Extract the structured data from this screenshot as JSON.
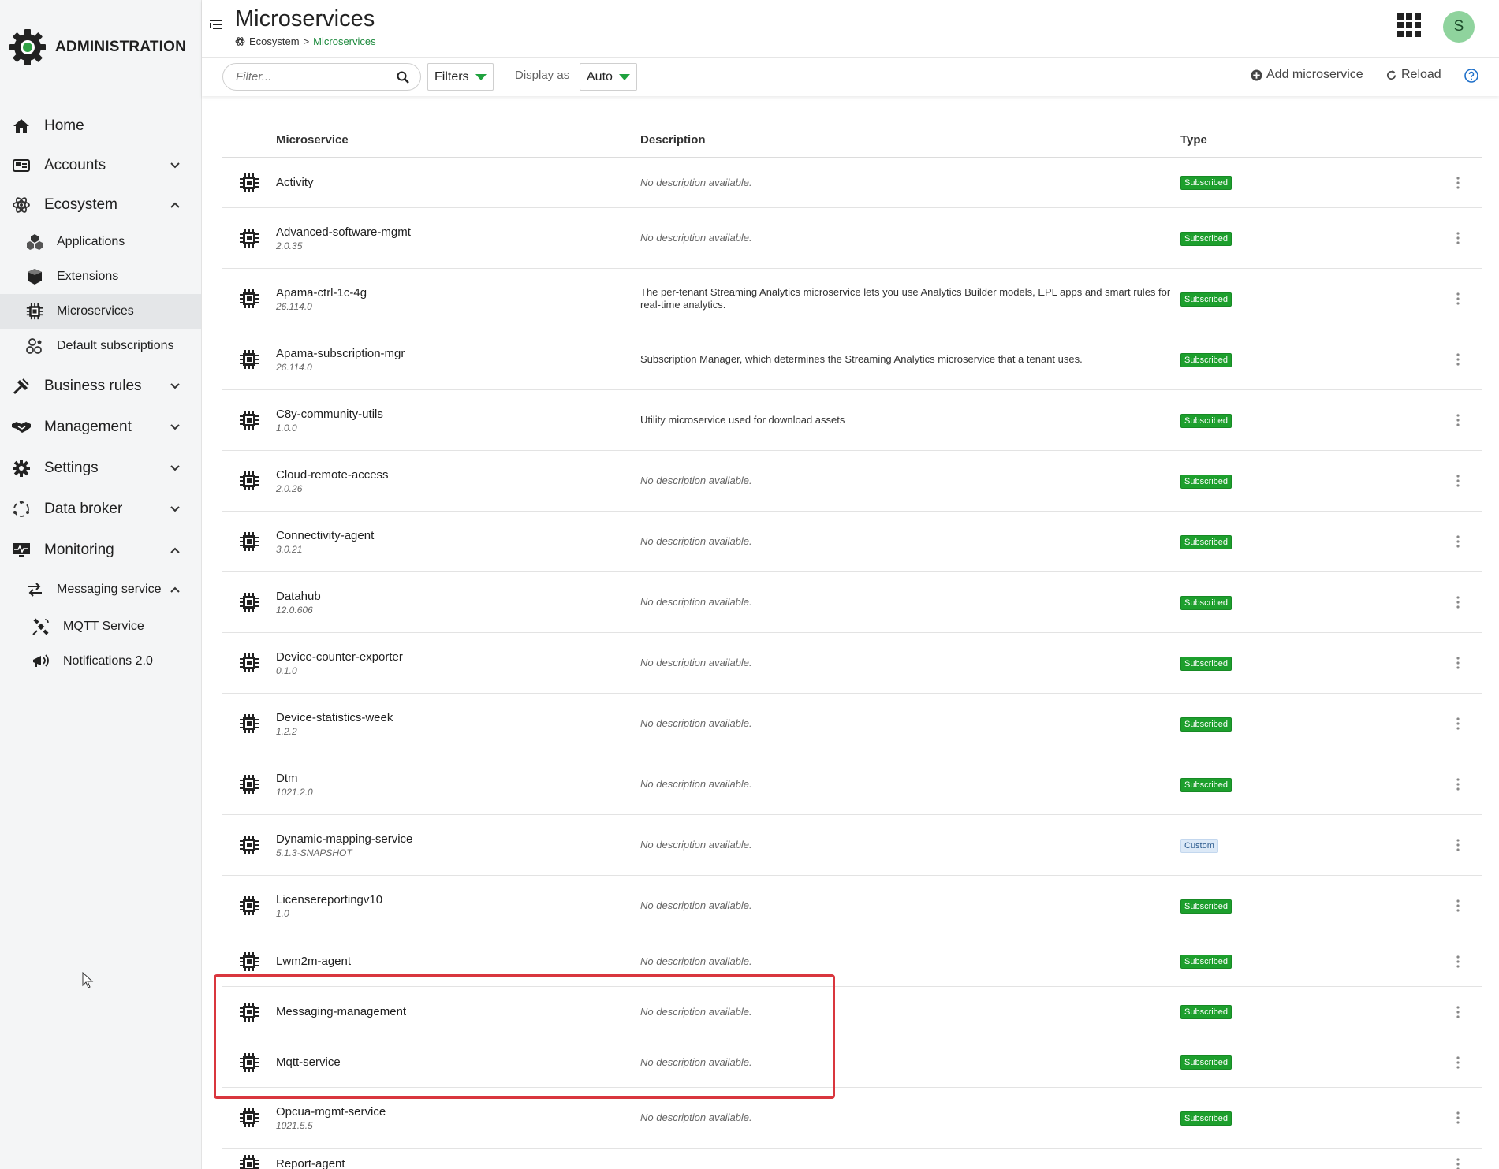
{
  "app": {
    "brand_name": "ADMINISTRATION",
    "page_title": "Microservices",
    "breadcrumb": {
      "parent": "Ecosystem",
      "separator": ">",
      "current": "Microservices"
    },
    "user_initial": "S"
  },
  "sidebar": {
    "home": "Home",
    "accounts": "Accounts",
    "ecosystem": "Ecosystem",
    "ecosystem_items": {
      "applications": "Applications",
      "extensions": "Extensions",
      "microservices": "Microservices",
      "default_subscriptions": "Default subscriptions"
    },
    "business_rules": "Business rules",
    "management": "Management",
    "settings": "Settings",
    "data_broker": "Data broker",
    "monitoring": "Monitoring",
    "messaging_service": "Messaging service",
    "messaging_items": {
      "mqtt": "MQTT Service",
      "notifications": "Notifications 2.0"
    },
    "active_item": "Microservices"
  },
  "toolbar": {
    "filter_placeholder": "Filter...",
    "filters_label": "Filters",
    "display_as_label": "Display as",
    "display_as_value": "Auto",
    "add_label": "Add microservice",
    "reload_label": "Reload"
  },
  "table": {
    "headers": {
      "name": "Microservice",
      "description": "Description",
      "type": "Type"
    },
    "rows": [
      {
        "name": "Activity",
        "version": "",
        "description": "No description available.",
        "type": "Subscribed"
      },
      {
        "name": "Advanced-software-mgmt",
        "version": "2.0.35",
        "description": "No description available.",
        "type": "Subscribed"
      },
      {
        "name": "Apama-ctrl-1c-4g",
        "version": "26.114.0",
        "description": "The per-tenant Streaming Analytics microservice lets you use Analytics Builder models, EPL apps and smart rules for real-time analytics.",
        "type": "Subscribed"
      },
      {
        "name": "Apama-subscription-mgr",
        "version": "26.114.0",
        "description": "Subscription Manager, which determines the Streaming Analytics microservice that a tenant uses.",
        "type": "Subscribed"
      },
      {
        "name": "C8y-community-utils",
        "version": "1.0.0",
        "description": "Utility microservice used for download assets",
        "type": "Subscribed"
      },
      {
        "name": "Cloud-remote-access",
        "version": "2.0.26",
        "description": "No description available.",
        "type": "Subscribed"
      },
      {
        "name": "Connectivity-agent",
        "version": "3.0.21",
        "description": "No description available.",
        "type": "Subscribed"
      },
      {
        "name": "Datahub",
        "version": "12.0.606",
        "description": "No description available.",
        "type": "Subscribed"
      },
      {
        "name": "Device-counter-exporter",
        "version": "0.1.0",
        "description": "No description available.",
        "type": "Subscribed"
      },
      {
        "name": "Device-statistics-week",
        "version": "1.2.2",
        "description": "No description available.",
        "type": "Subscribed"
      },
      {
        "name": "Dtm",
        "version": "1021.2.0",
        "description": "No description available.",
        "type": "Subscribed"
      },
      {
        "name": "Dynamic-mapping-service",
        "version": "5.1.3-SNAPSHOT",
        "description": "No description available.",
        "type": "Custom"
      },
      {
        "name": "Licensereportingv10",
        "version": "1.0",
        "description": "No description available.",
        "type": "Subscribed"
      },
      {
        "name": "Lwm2m-agent",
        "version": "",
        "description": "No description available.",
        "type": "Subscribed"
      },
      {
        "name": "Messaging-management",
        "version": "",
        "description": "No description available.",
        "type": "Subscribed"
      },
      {
        "name": "Mqtt-service",
        "version": "",
        "description": "No description available.",
        "type": "Subscribed"
      },
      {
        "name": "Opcua-mgmt-service",
        "version": "1021.5.5",
        "description": "No description available.",
        "type": "Subscribed"
      },
      {
        "name": "Report-agent",
        "version": "",
        "description": "",
        "type": ""
      }
    ]
  },
  "colors": {
    "accent_green": "#1d9f2d",
    "highlight_red": "#d9363e",
    "avatar_green": "#8fd39d"
  }
}
